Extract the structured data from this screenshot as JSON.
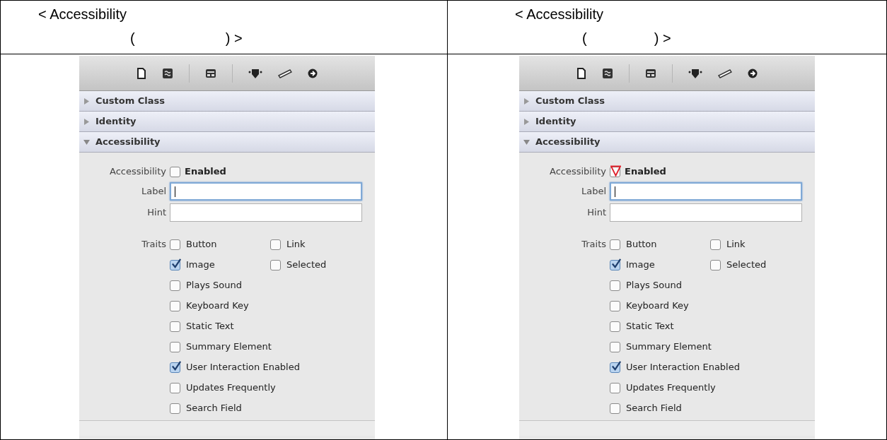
{
  "columns": [
    {
      "title": "< Accessibility",
      "subtitle_open": "(",
      "subtitle_close": ") >",
      "panel": {
        "sections": [
          {
            "label": "Custom Class",
            "expanded": false
          },
          {
            "label": "Identity",
            "expanded": false
          },
          {
            "label": "Accessibility",
            "expanded": true
          }
        ],
        "accessibility": {
          "label": "Accessibility",
          "checkbox": {
            "label": "Enabled",
            "checked": false
          }
        },
        "fields": [
          {
            "label": "Label",
            "focused": true
          },
          {
            "label": "Hint",
            "focused": false
          }
        ],
        "traits_label": "Traits",
        "traits": [
          {
            "label": "Button",
            "checked": false
          },
          {
            "label": "Link",
            "checked": false
          },
          {
            "label": "Image",
            "checked": true
          },
          {
            "label": "Selected",
            "checked": false
          },
          {
            "label": "Plays Sound",
            "checked": false
          },
          {
            "label": "Keyboard Key",
            "checked": false
          },
          {
            "label": "Static Text",
            "checked": false
          },
          {
            "label": "Summary Element",
            "checked": false
          },
          {
            "label": "User Interaction Enabled",
            "checked": true
          },
          {
            "label": "Updates Frequently",
            "checked": false
          },
          {
            "label": "Search Field",
            "checked": false
          }
        ]
      }
    },
    {
      "title": "< Accessibility",
      "subtitle_open": "(",
      "subtitle_close": ") >",
      "panel": {
        "sections": [
          {
            "label": "Custom Class",
            "expanded": false
          },
          {
            "label": "Identity",
            "expanded": false
          },
          {
            "label": "Accessibility",
            "expanded": true
          }
        ],
        "accessibility": {
          "label": "Accessibility",
          "checkbox": {
            "label": "Enabled",
            "checked": true,
            "annotated": true
          }
        },
        "fields": [
          {
            "label": "Label",
            "focused": true
          },
          {
            "label": "Hint",
            "focused": false
          }
        ],
        "traits_label": "Traits",
        "traits": [
          {
            "label": "Button",
            "checked": false
          },
          {
            "label": "Link",
            "checked": false
          },
          {
            "label": "Image",
            "checked": true
          },
          {
            "label": "Selected",
            "checked": false
          },
          {
            "label": "Plays Sound",
            "checked": false
          },
          {
            "label": "Keyboard Key",
            "checked": false
          },
          {
            "label": "Static Text",
            "checked": false
          },
          {
            "label": "Summary Element",
            "checked": false
          },
          {
            "label": "User Interaction Enabled",
            "checked": true
          },
          {
            "label": "Updates Frequently",
            "checked": false
          },
          {
            "label": "Search Field",
            "checked": false
          }
        ]
      }
    }
  ]
}
